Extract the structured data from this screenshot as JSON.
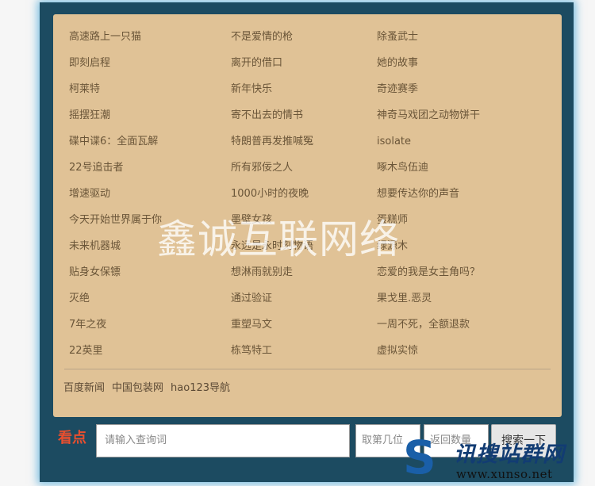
{
  "list": {
    "items": [
      "高速路上一只猫",
      "不是爱情的枪",
      "除蚤武士",
      "即刻启程",
      "离开的借口",
      "她的故事",
      "柯莱特",
      "新年快乐",
      "奇迹赛季",
      "摇摆狂潮",
      "寄不出去的情书",
      "神奇马戏团之动物饼干",
      "碟中谍6：全面瓦解",
      "特朗普再发推喊冤",
      "isolate",
      "22号追击者",
      "所有邪佞之人",
      "啄木鸟伍迪",
      "增速驱动",
      "1000小时的夜晚",
      "想要传达你的声音",
      "今天开始世界属于你",
      "墨壁女孩",
      "蛋糕师",
      "未来机器城",
      "永远是永时刻物语",
      "绿源木",
      "贴身女保镖",
      "想淋雨就别走",
      "恋爱的我是女主角吗？",
      "灭绝",
      "通过验证",
      "果戈里.恶灵",
      "7年之夜",
      "重塑马文",
      "一周不死，全额退款",
      "22英里",
      "栋笃特工",
      "虚拟实惊"
    ]
  },
  "footer": {
    "links": [
      "百度新闻",
      "中国包装网",
      "hao123导航"
    ]
  },
  "watermark": "鑫诚互联网络",
  "search_bar": {
    "label": "看点",
    "query_placeholder": "请输入查询词",
    "page_placeholder": "取第几位",
    "count_placeholder": "返回数量",
    "button_label": "搜索一下"
  },
  "logo": {
    "mark": "S",
    "name": "讯搜站群网",
    "url": "www.xunso.net"
  }
}
